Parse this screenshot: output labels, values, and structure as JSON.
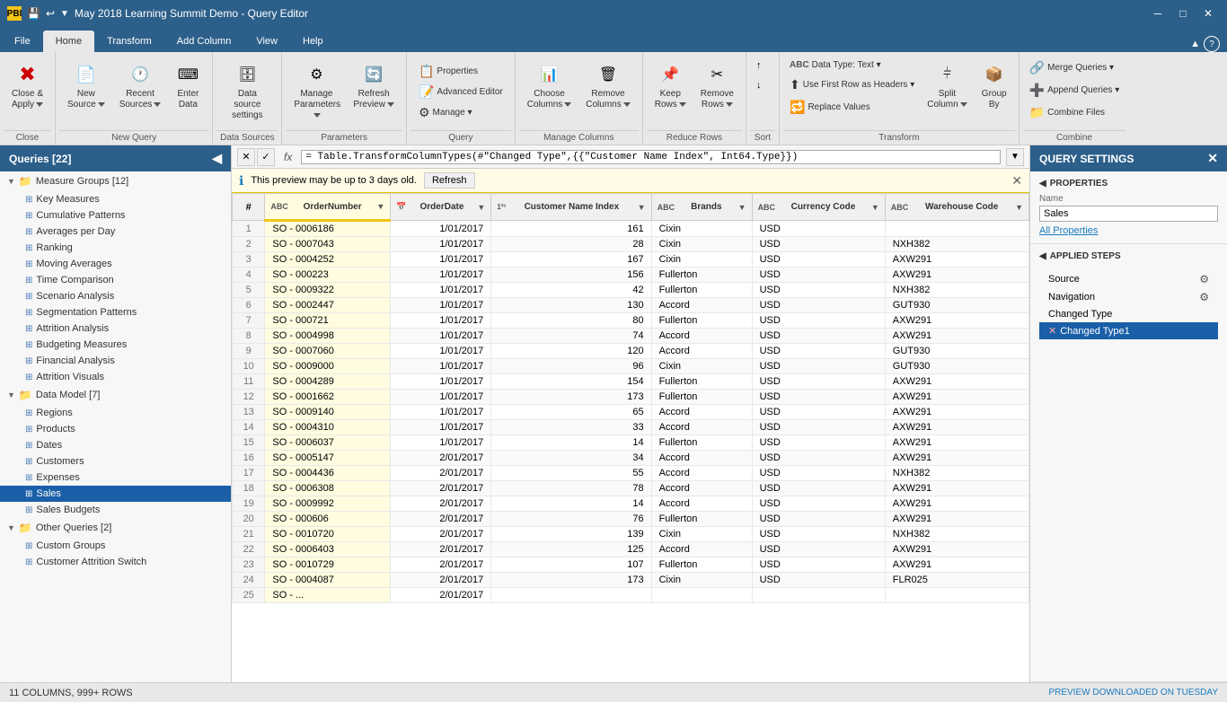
{
  "titleBar": {
    "title": "May 2018 Learning Summit Demo - Query Editor",
    "iconLabel": "PBI"
  },
  "ribbonTabs": {
    "tabs": [
      "File",
      "Home",
      "Transform",
      "Add Column",
      "View",
      "Help"
    ],
    "activeTab": "Home"
  },
  "ribbonGroups": {
    "close": {
      "label": "Close",
      "buttons": [
        {
          "id": "close-apply",
          "label": "Close &\nApply",
          "icon": "✖",
          "dropdown": true
        }
      ]
    },
    "newQuery": {
      "label": "New Query",
      "buttons": [
        {
          "id": "new-source",
          "label": "New\nSource",
          "icon": "📄",
          "dropdown": true
        },
        {
          "id": "recent-sources",
          "label": "Recent\nSources",
          "icon": "🕐",
          "dropdown": true
        },
        {
          "id": "enter-data",
          "label": "Enter\nData",
          "icon": "⌨"
        }
      ]
    },
    "dataSources": {
      "label": "Data Sources",
      "buttons": [
        {
          "id": "data-source-settings",
          "label": "Data source\nsettings",
          "icon": "🗄"
        }
      ]
    },
    "parameters": {
      "label": "Parameters",
      "buttons": [
        {
          "id": "manage-params",
          "label": "Manage\nParameters",
          "icon": "⚙",
          "dropdown": true
        },
        {
          "id": "refresh-preview",
          "label": "Refresh\nPreview",
          "icon": "🔄",
          "dropdown": true
        }
      ]
    },
    "query": {
      "label": "Query",
      "smallButtons": [
        {
          "id": "properties",
          "label": "Properties",
          "icon": "📋"
        },
        {
          "id": "advanced-editor",
          "label": "Advanced Editor",
          "icon": "📝"
        },
        {
          "id": "manage",
          "label": "Manage ▾",
          "icon": "⚙"
        }
      ]
    },
    "manageColumns": {
      "label": "Manage Columns",
      "buttons": [
        {
          "id": "choose-columns",
          "label": "Choose\nColumns",
          "icon": "📊",
          "dropdown": true
        },
        {
          "id": "remove-columns",
          "label": "Remove\nColumns",
          "icon": "🗑",
          "dropdown": true
        }
      ]
    },
    "reduceRows": {
      "label": "Reduce Rows",
      "buttons": [
        {
          "id": "keep-rows",
          "label": "Keep\nRows",
          "icon": "📌",
          "dropdown": true
        },
        {
          "id": "remove-rows",
          "label": "Remove\nRows",
          "icon": "✂",
          "dropdown": true
        }
      ]
    },
    "sort": {
      "label": "Sort",
      "buttons": [
        {
          "id": "sort-asc",
          "label": "",
          "icon": "↑"
        },
        {
          "id": "sort-desc",
          "label": "",
          "icon": "↓"
        }
      ]
    },
    "transform": {
      "label": "Transform",
      "smallButtons": [
        {
          "id": "data-type",
          "label": "Data Type: Text ▾",
          "icon": "ABC"
        },
        {
          "id": "use-first-row",
          "label": "Use First Row as Headers ▾",
          "icon": "⬆"
        },
        {
          "id": "replace-values",
          "label": "Replace Values",
          "icon": "🔁"
        }
      ],
      "buttons": [
        {
          "id": "split-column",
          "label": "Split\nColumn",
          "icon": "⫩",
          "dropdown": true
        },
        {
          "id": "group-by",
          "label": "Group\nBy",
          "icon": "📦"
        }
      ]
    },
    "combine": {
      "label": "Combine",
      "smallButtons": [
        {
          "id": "merge-queries",
          "label": "Merge Queries ▾",
          "icon": "🔗"
        },
        {
          "id": "append-queries",
          "label": "Append Queries ▾",
          "icon": "➕"
        },
        {
          "id": "combine-files",
          "label": "Combine Files",
          "icon": "📁"
        }
      ]
    }
  },
  "sidebar": {
    "title": "Queries [22]",
    "groups": [
      {
        "id": "measure-groups",
        "label": "Measure Groups [12]",
        "expanded": true,
        "items": [
          {
            "id": "key-measures",
            "label": "Key Measures"
          },
          {
            "id": "cumulative-patterns",
            "label": "Cumulative Patterns"
          },
          {
            "id": "averages-per-day",
            "label": "Averages per Day"
          },
          {
            "id": "ranking",
            "label": "Ranking"
          },
          {
            "id": "moving-averages",
            "label": "Moving Averages"
          },
          {
            "id": "time-comparison",
            "label": "Time Comparison"
          },
          {
            "id": "scenario-analysis",
            "label": "Scenario Analysis"
          },
          {
            "id": "segmentation-patterns",
            "label": "Segmentation Patterns"
          },
          {
            "id": "attrition-analysis",
            "label": "Attrition Analysis"
          },
          {
            "id": "budgeting-measures",
            "label": "Budgeting Measures"
          },
          {
            "id": "financial-analysis",
            "label": "Financial Analysis"
          },
          {
            "id": "attrition-visuals",
            "label": "Attrition Visuals"
          }
        ]
      },
      {
        "id": "data-model",
        "label": "Data Model [7]",
        "expanded": true,
        "items": [
          {
            "id": "regions",
            "label": "Regions"
          },
          {
            "id": "products",
            "label": "Products"
          },
          {
            "id": "dates",
            "label": "Dates"
          },
          {
            "id": "customers",
            "label": "Customers"
          },
          {
            "id": "expenses",
            "label": "Expenses"
          },
          {
            "id": "sales",
            "label": "Sales",
            "selected": true
          },
          {
            "id": "sales-budgets",
            "label": "Sales Budgets"
          }
        ]
      },
      {
        "id": "other-queries",
        "label": "Other Queries [2]",
        "expanded": true,
        "items": [
          {
            "id": "custom-groups",
            "label": "Custom Groups"
          },
          {
            "id": "customer-attrition",
            "label": "Customer Attrition Switch"
          }
        ]
      }
    ]
  },
  "formulaBar": {
    "formula": "= Table.TransformColumnTypes(#\"Changed Type\",{{\"Customer Name Index\", Int64.Type}})"
  },
  "notification": {
    "text": "This preview may be up to 3 days old.",
    "refreshLabel": "Refresh"
  },
  "table": {
    "columns": [
      {
        "id": "row-num",
        "label": "#",
        "type": ""
      },
      {
        "id": "order-number",
        "label": "OrderNumber",
        "type": "ABC",
        "filter": true,
        "highlight": true
      },
      {
        "id": "order-date",
        "label": "OrderDate",
        "type": "📅",
        "filter": true
      },
      {
        "id": "customer-name-index",
        "label": "Customer Name Index",
        "type": "123",
        "filter": true
      },
      {
        "id": "brands",
        "label": "Brands",
        "type": "ABC",
        "filter": true
      },
      {
        "id": "currency-code",
        "label": "Currency Code",
        "type": "ABC",
        "filter": true
      },
      {
        "id": "warehouse-code",
        "label": "Warehouse Code",
        "type": "ABC",
        "filter": true
      }
    ],
    "rows": [
      [
        1,
        "SO - 0006186",
        "1/01/2017",
        161,
        "Cixin",
        "USD",
        ""
      ],
      [
        2,
        "SO - 0007043",
        "1/01/2017",
        28,
        "Cixin",
        "USD",
        "NXH382"
      ],
      [
        3,
        "SO - 0004252",
        "1/01/2017",
        167,
        "Cixin",
        "USD",
        "AXW291"
      ],
      [
        4,
        "SO - 000223",
        "1/01/2017",
        156,
        "Fullerton",
        "USD",
        "AXW291"
      ],
      [
        5,
        "SO - 0009322",
        "1/01/2017",
        42,
        "Fullerton",
        "USD",
        "NXH382"
      ],
      [
        6,
        "SO - 0002447",
        "1/01/2017",
        130,
        "Accord",
        "USD",
        "GUT930"
      ],
      [
        7,
        "SO - 000721",
        "1/01/2017",
        80,
        "Fullerton",
        "USD",
        "AXW291"
      ],
      [
        8,
        "SO - 0004998",
        "1/01/2017",
        74,
        "Accord",
        "USD",
        "AXW291"
      ],
      [
        9,
        "SO - 0007060",
        "1/01/2017",
        120,
        "Accord",
        "USD",
        "GUT930"
      ],
      [
        10,
        "SO - 0009000",
        "1/01/2017",
        96,
        "Cixin",
        "USD",
        "GUT930"
      ],
      [
        11,
        "SO - 0004289",
        "1/01/2017",
        154,
        "Fullerton",
        "USD",
        "AXW291"
      ],
      [
        12,
        "SO - 0001662",
        "1/01/2017",
        173,
        "Fullerton",
        "USD",
        "AXW291"
      ],
      [
        13,
        "SO - 0009140",
        "1/01/2017",
        65,
        "Accord",
        "USD",
        "AXW291"
      ],
      [
        14,
        "SO - 0004310",
        "1/01/2017",
        33,
        "Accord",
        "USD",
        "AXW291"
      ],
      [
        15,
        "SO - 0006037",
        "1/01/2017",
        14,
        "Fullerton",
        "USD",
        "AXW291"
      ],
      [
        16,
        "SO - 0005147",
        "2/01/2017",
        34,
        "Accord",
        "USD",
        "AXW291"
      ],
      [
        17,
        "SO - 0004436",
        "2/01/2017",
        55,
        "Accord",
        "USD",
        "NXH382"
      ],
      [
        18,
        "SO - 0006308",
        "2/01/2017",
        78,
        "Accord",
        "USD",
        "AXW291"
      ],
      [
        19,
        "SO - 0009992",
        "2/01/2017",
        14,
        "Accord",
        "USD",
        "AXW291"
      ],
      [
        20,
        "SO - 000606",
        "2/01/2017",
        76,
        "Fullerton",
        "USD",
        "AXW291"
      ],
      [
        21,
        "SO - 0010720",
        "2/01/2017",
        139,
        "Cixin",
        "USD",
        "NXH382"
      ],
      [
        22,
        "SO - 0006403",
        "2/01/2017",
        125,
        "Accord",
        "USD",
        "AXW291"
      ],
      [
        23,
        "SO - 0010729",
        "2/01/2017",
        107,
        "Fullerton",
        "USD",
        "AXW291"
      ],
      [
        24,
        "SO - 0004087",
        "2/01/2017",
        173,
        "Cixin",
        "USD",
        "FLR025"
      ],
      [
        25,
        "SO - ...",
        "2/01/2017",
        "",
        "",
        "",
        ""
      ]
    ]
  },
  "querySettings": {
    "title": "QUERY SETTINGS",
    "properties": {
      "title": "PROPERTIES",
      "nameLabel": "Name",
      "nameValue": "Sales",
      "allPropertiesLabel": "All Properties"
    },
    "appliedSteps": {
      "title": "APPLIED STEPS",
      "steps": [
        {
          "id": "source",
          "label": "Source",
          "hasGear": true,
          "hasDelete": false
        },
        {
          "id": "navigation",
          "label": "Navigation",
          "hasGear": true,
          "hasDelete": false
        },
        {
          "id": "changed-type",
          "label": "Changed Type",
          "hasGear": false,
          "hasDelete": false
        },
        {
          "id": "changed-type1",
          "label": "Changed Type1",
          "hasGear": false,
          "hasDelete": true,
          "active": true
        }
      ]
    }
  },
  "statusBar": {
    "left": "11 COLUMNS, 999+ ROWS",
    "right": "PREVIEW DOWNLOADED ON TUESDAY"
  }
}
